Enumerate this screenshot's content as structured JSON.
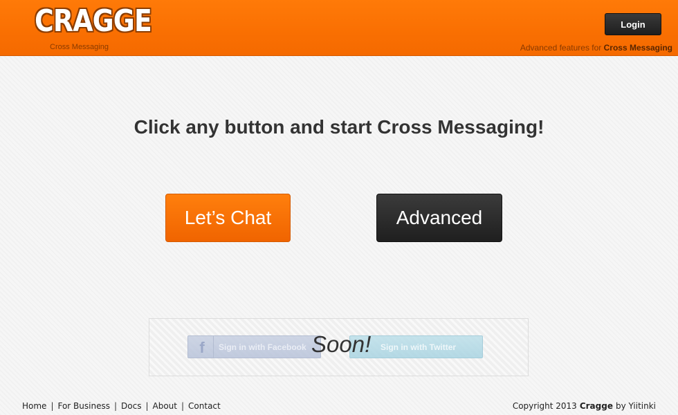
{
  "header": {
    "logo_text": "CRAGGE",
    "logo_subtitle": "Cross Messaging",
    "login_label": "Login",
    "tagline_prefix": "Advanced features for",
    "tagline_bold": "Cross Messaging"
  },
  "main": {
    "headline_prefix": "Click any button and start",
    "headline_bold": "Cross Messaging!",
    "chat_button_label": "Let’s Chat",
    "advanced_button_label": "Advanced"
  },
  "social": {
    "facebook_icon": "f",
    "facebook_label": "Sign in with Facebook",
    "twitter_label": "Sign in with Twitter",
    "soon_text": "Soon!"
  },
  "footer": {
    "nav": [
      "Home",
      "For Business",
      "Docs",
      "About",
      "Contact"
    ],
    "separator": "|",
    "copyright_prefix": "Copyright 2013",
    "copyright_brand": "Cragge",
    "copyright_suffix": "by Yiitinki"
  },
  "colors": {
    "brand_orange": "#f96f02",
    "dark_button": "#2a2a2a"
  }
}
